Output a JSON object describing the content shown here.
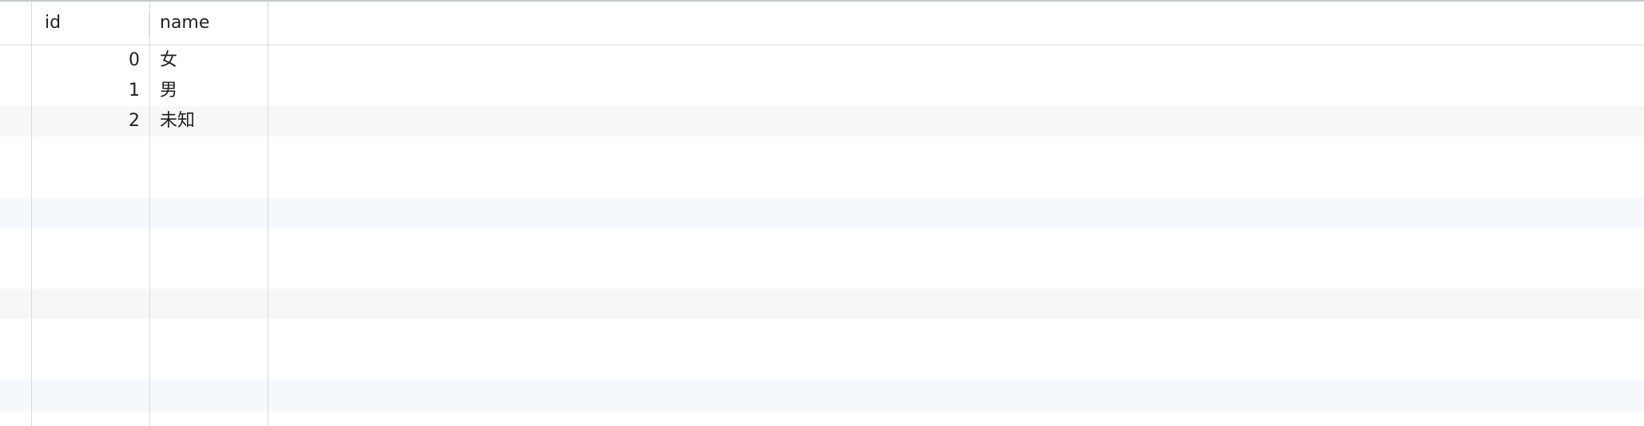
{
  "table": {
    "columns": [
      {
        "key": "id",
        "label": "id"
      },
      {
        "key": "name",
        "label": "name"
      }
    ],
    "rows": [
      {
        "id": "0",
        "name": "女"
      },
      {
        "id": "1",
        "name": "男"
      },
      {
        "id": "2",
        "name": "未知"
      }
    ]
  },
  "colors": {
    "header_bg": "#ffffff",
    "row_stripe_gray": "#f7f7f7",
    "row_stripe_blue": "#f5f8fc",
    "gridline": "#d9d9d9",
    "text": "#1f1f1f"
  }
}
